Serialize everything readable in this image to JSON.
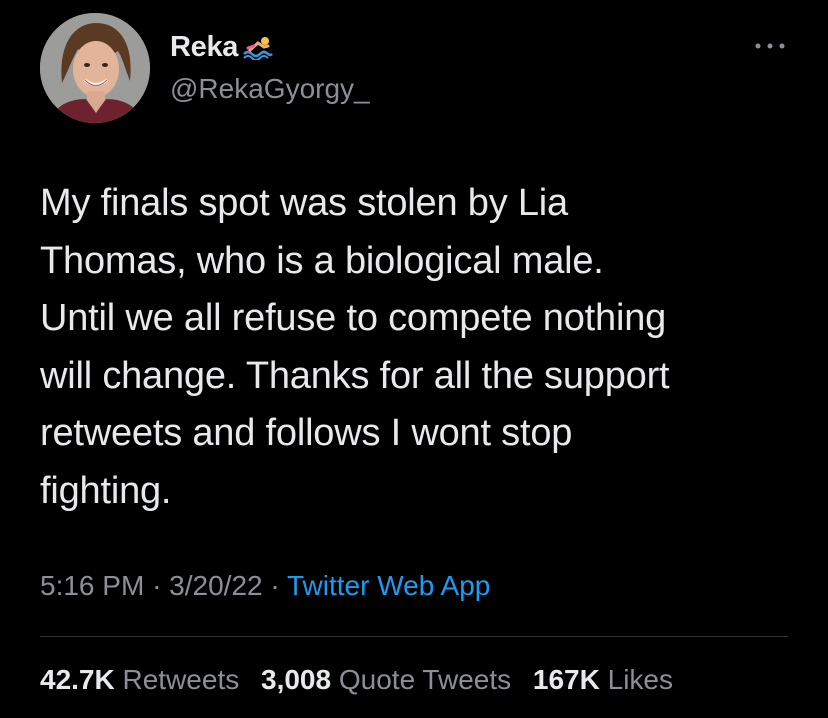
{
  "author": {
    "display_name": "Reka",
    "handle": "@RekaGyorgy_",
    "emoji_icon": "swimmer-emoji"
  },
  "tweet": {
    "lines": [
      "My finals spot was stolen by Lia",
      "Thomas, who is a biological male.",
      "Until we all refuse to compete nothing",
      "will change. Thanks for all the support",
      "retweets and follows I wont stop",
      "fighting."
    ],
    "time": "5:16 PM",
    "separator": "·",
    "date": "3/20/22",
    "source": "Twitter Web App"
  },
  "stats": {
    "retweets_count": "42.7K",
    "retweets_label": "Retweets",
    "quotes_count": "3,008",
    "quotes_label": "Quote Tweets",
    "likes_count": "167K",
    "likes_label": "Likes"
  },
  "colors": {
    "background": "#000000",
    "text": "#e7e9ea",
    "secondary": "#8b9096",
    "link": "#1d9bf0",
    "divider": "#2f3336"
  }
}
